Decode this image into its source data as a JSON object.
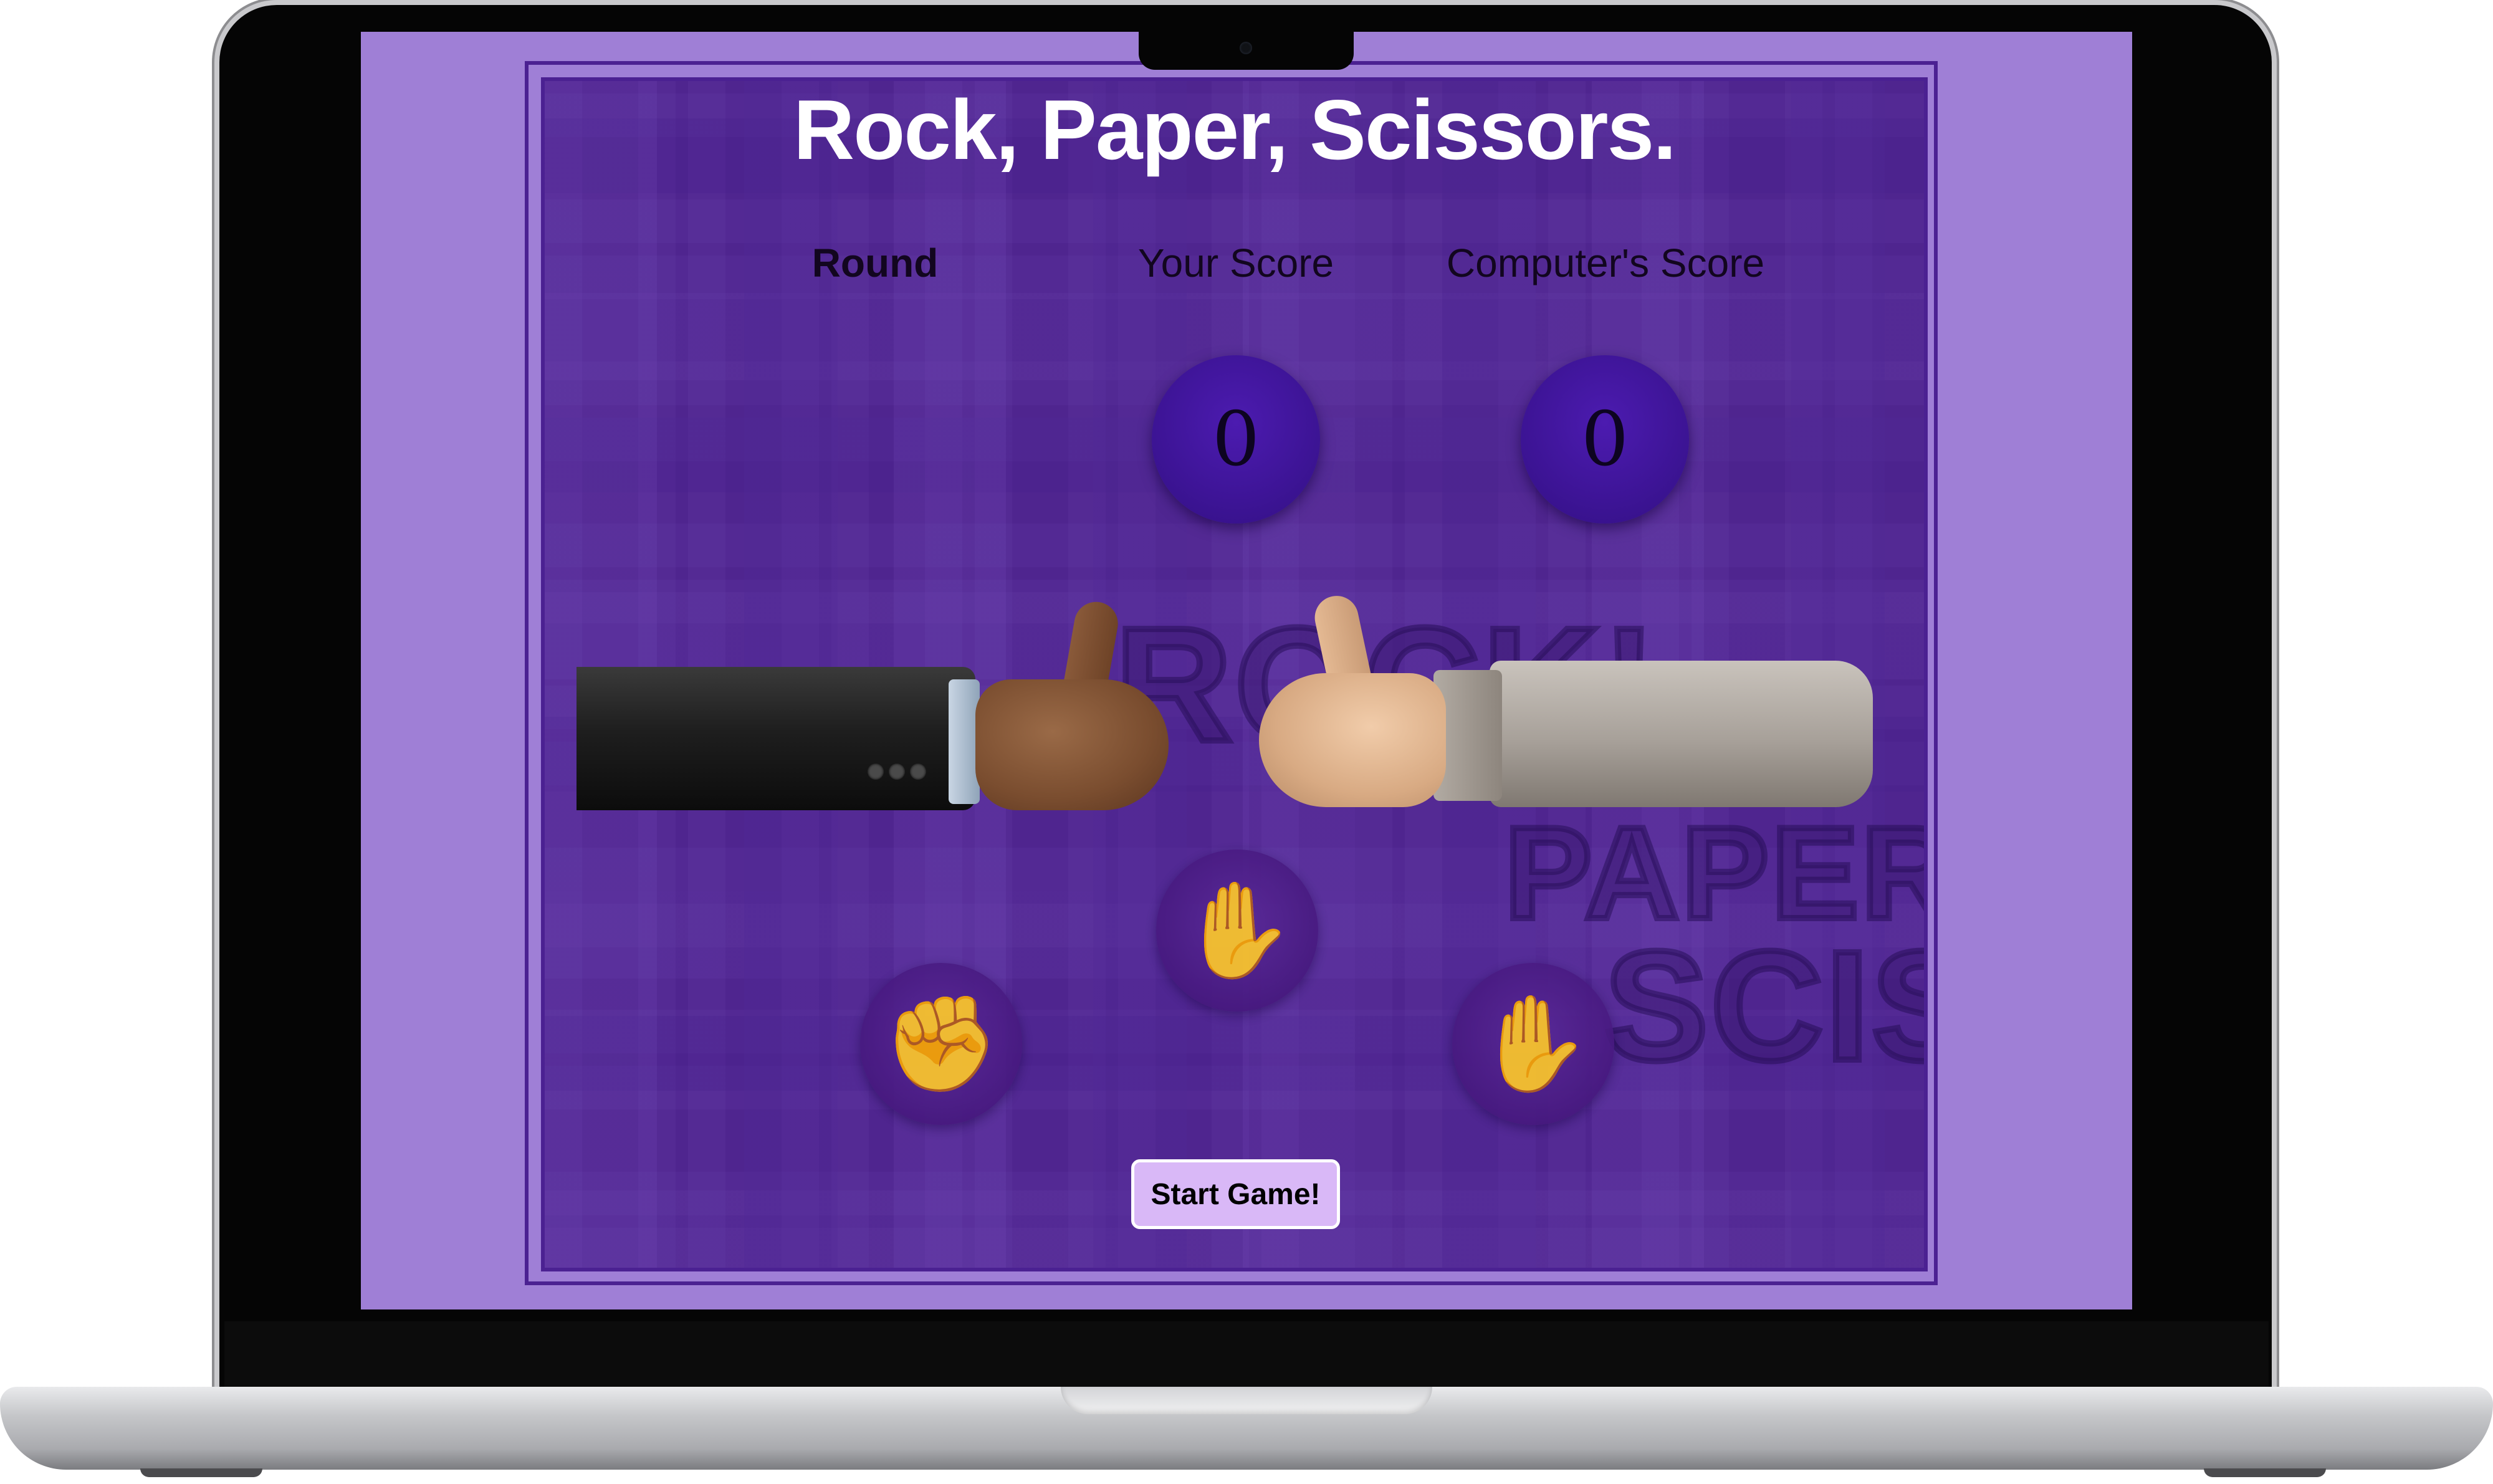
{
  "game": {
    "title": "Rock, Paper, Scissors.",
    "columns": {
      "round_label": "Round",
      "your_score_label": "Your Score",
      "computer_score_label": "Computer's Score"
    },
    "scores": {
      "round": "",
      "your_score": "0",
      "computer_score": "0"
    },
    "background_words": [
      "ROCK!",
      "PAPER",
      "SCISSORS!"
    ],
    "choices": [
      {
        "name": "rock",
        "icon": "raised-fist-icon"
      },
      {
        "name": "paper",
        "icon": "raised-hand-icon"
      },
      {
        "name": "scissors",
        "icon": "vulcan-hand-icon"
      }
    ],
    "start_button_label": "Start Game!"
  },
  "colors": {
    "screen_background": "#9f7fd6",
    "board_background": "#4f258f",
    "start_button": "#d9b8f7"
  }
}
